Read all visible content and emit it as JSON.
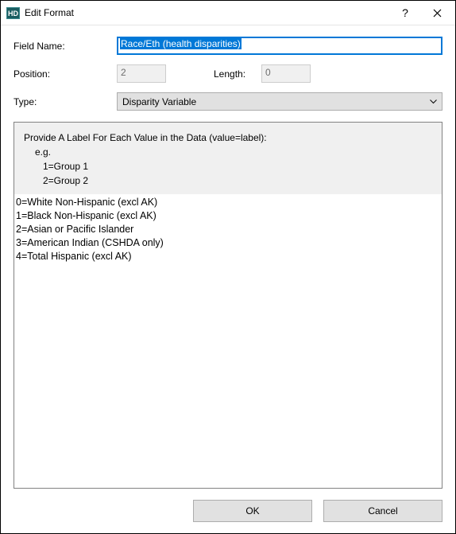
{
  "window": {
    "title": "Edit Format"
  },
  "labels": {
    "field_name": "Field Name:",
    "position": "Position:",
    "length": "Length:",
    "type": "Type:"
  },
  "values": {
    "field_name": "Race/Eth (health disparities)",
    "position": "2",
    "length": "0",
    "type": "Disparity Variable"
  },
  "panel": {
    "header_line1": "Provide A Label For Each Value in the Data (value=label):",
    "header_eg": "e.g.",
    "header_g1": "1=Group 1",
    "header_g2": "2=Group 2",
    "body": "0=White Non-Hispanic (excl AK)\n1=Black Non-Hispanic (excl AK)\n2=Asian or Pacific Islander\n3=American Indian (CSHDA only)\n4=Total Hispanic (excl AK)"
  },
  "buttons": {
    "ok": "OK",
    "cancel": "Cancel"
  }
}
